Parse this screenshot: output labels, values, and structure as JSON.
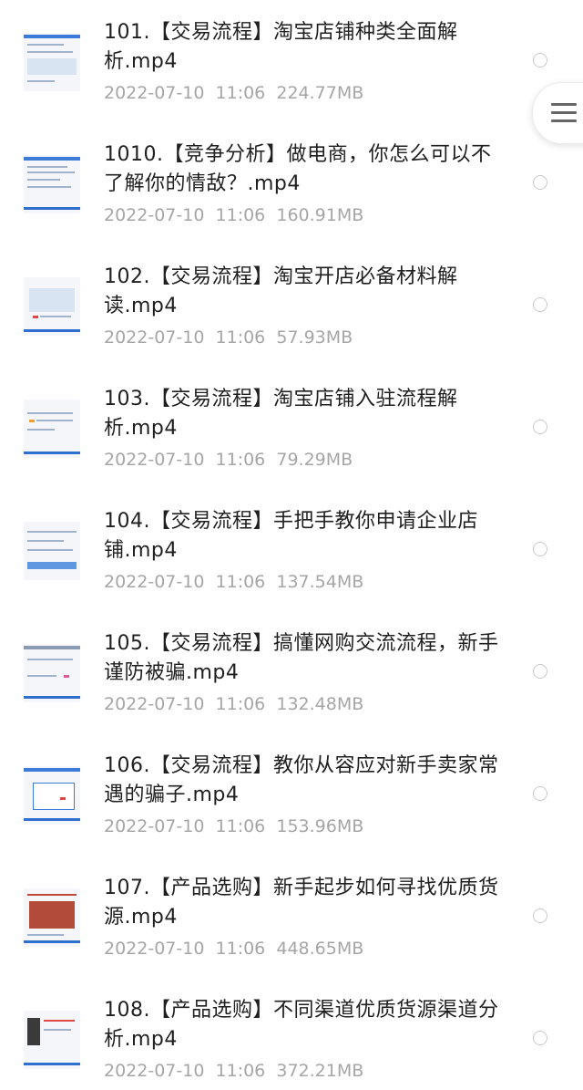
{
  "files": [
    {
      "title": "101.【交易流程】淘宝店铺种类全面解析.mp4",
      "date": "2022-07-10",
      "time": "11:06",
      "size": "224.77MB",
      "thumbnail": "web-page-screenshot"
    },
    {
      "title": "1010.【竞争分析】做电商，你怎么可以不了解你的情敌？.mp4",
      "date": "2022-07-10",
      "time": "11:06",
      "size": "160.91MB",
      "thumbnail": "web-page-screenshot"
    },
    {
      "title": "102.【交易流程】淘宝开店必备材料解读.mp4",
      "date": "2022-07-10",
      "time": "11:06",
      "size": "57.93MB",
      "thumbnail": "web-page-screenshot"
    },
    {
      "title": "103.【交易流程】淘宝店铺入驻流程解析.mp4",
      "date": "2022-07-10",
      "time": "11:06",
      "size": "79.29MB",
      "thumbnail": "web-page-screenshot"
    },
    {
      "title": "104.【交易流程】手把手教你申请企业店铺.mp4",
      "date": "2022-07-10",
      "time": "11:06",
      "size": "137.54MB",
      "thumbnail": "web-page-screenshot"
    },
    {
      "title": "105.【交易流程】搞懂网购交流流程，新手谨防被骗.mp4",
      "date": "2022-07-10",
      "time": "11:06",
      "size": "132.48MB",
      "thumbnail": "web-page-screenshot"
    },
    {
      "title": "106.【交易流程】教你从容应对新手卖家常遇的骗子.mp4",
      "date": "2022-07-10",
      "time": "11:06",
      "size": "153.96MB",
      "thumbnail": "web-page-screenshot"
    },
    {
      "title": "107.【产品选购】新手起步如何寻找优质货源.mp4",
      "date": "2022-07-10",
      "time": "11:06",
      "size": "448.65MB",
      "thumbnail": "product-photo-screenshot"
    },
    {
      "title": "108.【产品选购】不同渠道优质货源渠道分析.mp4",
      "date": "2022-07-10",
      "time": "11:06",
      "size": "372.21MB",
      "thumbnail": "product-photo-screenshot"
    }
  ],
  "floating_menu": {
    "icon": "menu-icon"
  },
  "colors": {
    "title": "#1f1f1f",
    "meta": "#a6a6a6",
    "radio_border": "#c8c8c8",
    "accent": "#3d7bd8"
  }
}
